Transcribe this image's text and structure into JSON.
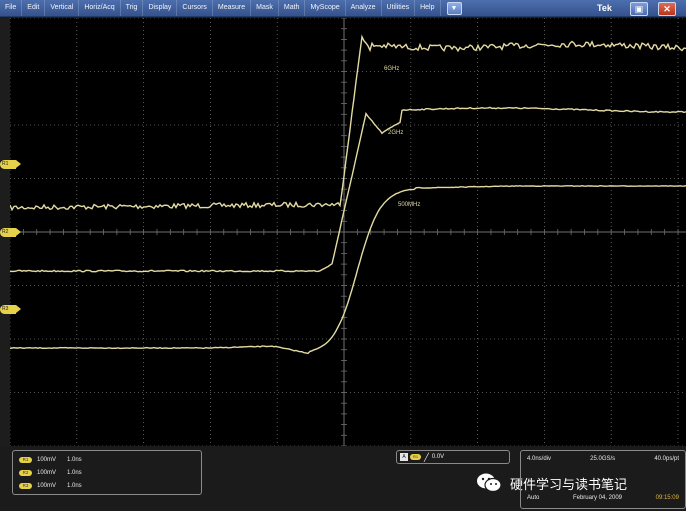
{
  "menu": {
    "items": [
      "File",
      "Edit",
      "Vertical",
      "Horiz/Acq",
      "Trig",
      "Display",
      "Cursors",
      "Measure",
      "Mask",
      "Math",
      "MyScope",
      "Analyze",
      "Utilities",
      "Help"
    ],
    "dropdown_icon": "chevron-down-icon",
    "logo": "Tek",
    "minimize_icon": "minimize-icon",
    "close_icon": "close-icon"
  },
  "traces": {
    "label_6ghz": "6GHz",
    "label_2ghz": "2GHz",
    "label_500mhz": "500MHz",
    "color": "#e3dba2"
  },
  "markers": {
    "ch1": "R1",
    "ch2": "R2",
    "ch3": "R3"
  },
  "channels": [
    {
      "badge": "R1",
      "scale": "100mV",
      "timebase": "1.0ns"
    },
    {
      "badge": "R2",
      "scale": "100mV",
      "timebase": "1.0ns"
    },
    {
      "badge": "R3",
      "scale": "100mV",
      "timebase": "1.0ns"
    }
  ],
  "trigger": {
    "source_label": "A",
    "channel": "R1",
    "slope": "╱",
    "level": "0.0V"
  },
  "horizontal": {
    "scale": "4.0ns/div",
    "sample_rate": "25.0GS/s",
    "resolution": "40.0ps/pt",
    "mode": "Auto",
    "date": "February 04, 2009",
    "time": "09:15:09"
  },
  "watermark": {
    "text": "硬件学习与读书笔记",
    "icon": "wechat-icon"
  },
  "colors": {
    "accent": "#e6d24a",
    "menubar": "#35528d",
    "grid": "#8a8a8a"
  }
}
